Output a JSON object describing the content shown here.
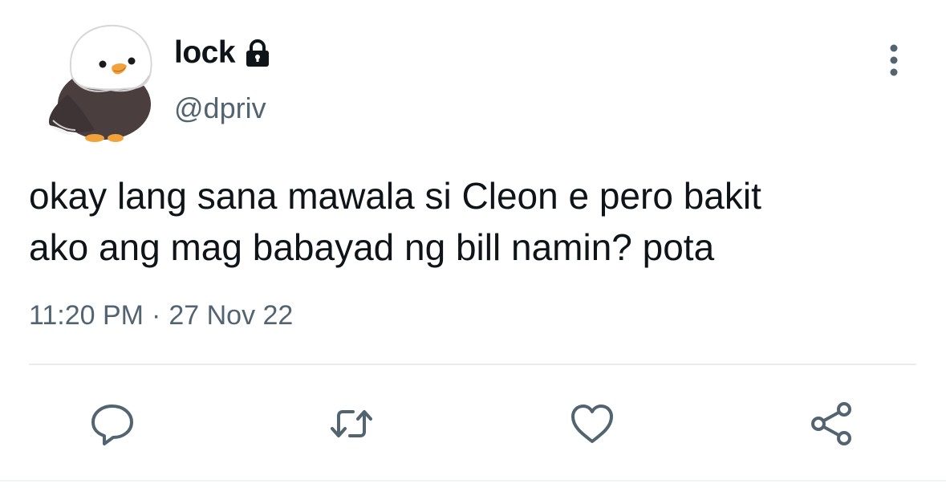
{
  "tweet": {
    "display_name": "lock",
    "handle": "@dpriv",
    "text_line1": "okay lang sana mawala si Cleon e pero bakit",
    "text_line2": "ako ang mag babayad ng bill namin? pota",
    "time": "11:20 PM",
    "separator": "·",
    "date": "27 Nov 22"
  },
  "icons": {
    "lock": "lock-icon",
    "more": "vertical-ellipsis-icon",
    "reply": "reply-icon",
    "retweet": "retweet-icon",
    "like": "heart-icon",
    "share": "share-icon"
  },
  "colors": {
    "text_primary": "#0f1419",
    "text_secondary": "#536471",
    "divider": "#e9edf0"
  }
}
